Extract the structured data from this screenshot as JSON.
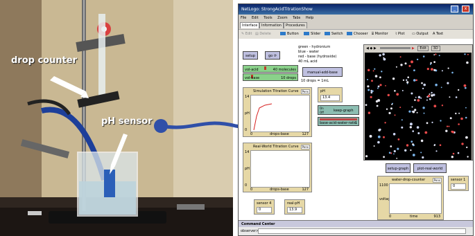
{
  "photo": {
    "drop_counter_label": "drop counter",
    "ph_sensor_label": "pH sensor"
  },
  "window": {
    "title": "NetLogo: StrongAcidTitrationShow",
    "menu": [
      "File",
      "Edit",
      "Tools",
      "Zoom",
      "Tabs",
      "Help"
    ],
    "tabs": [
      "Interface",
      "Information",
      "Procedures"
    ],
    "toolbar": {
      "edit": "Edit",
      "delete": "Delete",
      "button": "Button",
      "slider": "Slider",
      "switch": "Switch",
      "chooser": "Chooser",
      "monitor": "Monitor",
      "plot": "Plot",
      "output": "Output",
      "text": "Text"
    }
  },
  "interface": {
    "setup_label": "setup",
    "go_label": "go",
    "legend": {
      "line1": "green - hydronium",
      "line2": "blue - water",
      "line3": "red - base (hydroxide)",
      "line4": "40 mL acid"
    },
    "slider_acid": {
      "label": "vol-acid",
      "value": "40 molecules",
      "level": 0.4
    },
    "slider_base": {
      "label": "vol-base",
      "value": "10 drops",
      "level": 0.15
    },
    "manual_add_base_label": "manual-add-base",
    "drops_note": "10 drops = 1mL",
    "sim_plot": {
      "title": "Simulation Titration Curve",
      "pens": "Pens",
      "ylabel": "pH",
      "xlabel": "drops-base",
      "ymax": "14",
      "ymin": "0",
      "xmin": "0",
      "xmax": "127"
    },
    "ph_monitor": {
      "label": "pH",
      "value": "13.4"
    },
    "on_label": "On",
    "off_label": "Off",
    "keep_graph_label": "keep-graph",
    "ratio_label": "base-acid-water-ratio",
    "ratio_value": "1",
    "real_plot": {
      "title": "Real-World Titration Curve",
      "pens": "Pens",
      "ylabel": "pH",
      "xlabel": "drops-base",
      "ymax": "14",
      "ymin": "0",
      "xmin": "0",
      "xmax": "127"
    },
    "setup_graph_label": "setup-graph",
    "plot_real_world_label": "plot-real-world",
    "sensor4": {
      "label": "sensor 4",
      "value": "0"
    },
    "real_ph": {
      "label": "real-pH",
      "value": "13.9"
    },
    "sensor1": {
      "label": "sensor 1",
      "value": "0"
    },
    "wdc_plot": {
      "title": "water-drop-counter",
      "pens": "Pens",
      "ylabel": "voltage",
      "xlabel": "time",
      "ymax": "1100",
      "ymin": "0",
      "xmin": "0",
      "xmax": "913"
    },
    "world_controls": {
      "speed_label": "normal speed",
      "edit": "Edit",
      "three_d": "3D"
    }
  },
  "command_center": {
    "title": "Command Center",
    "agent": "observer>"
  },
  "colors": {
    "title_bar": "#0a246a",
    "slider": "#8ad18a",
    "button": "#bfc0e0",
    "monitor": "#e6d8a6",
    "world_bg": "#000000",
    "connector": "#2f4fa8"
  }
}
